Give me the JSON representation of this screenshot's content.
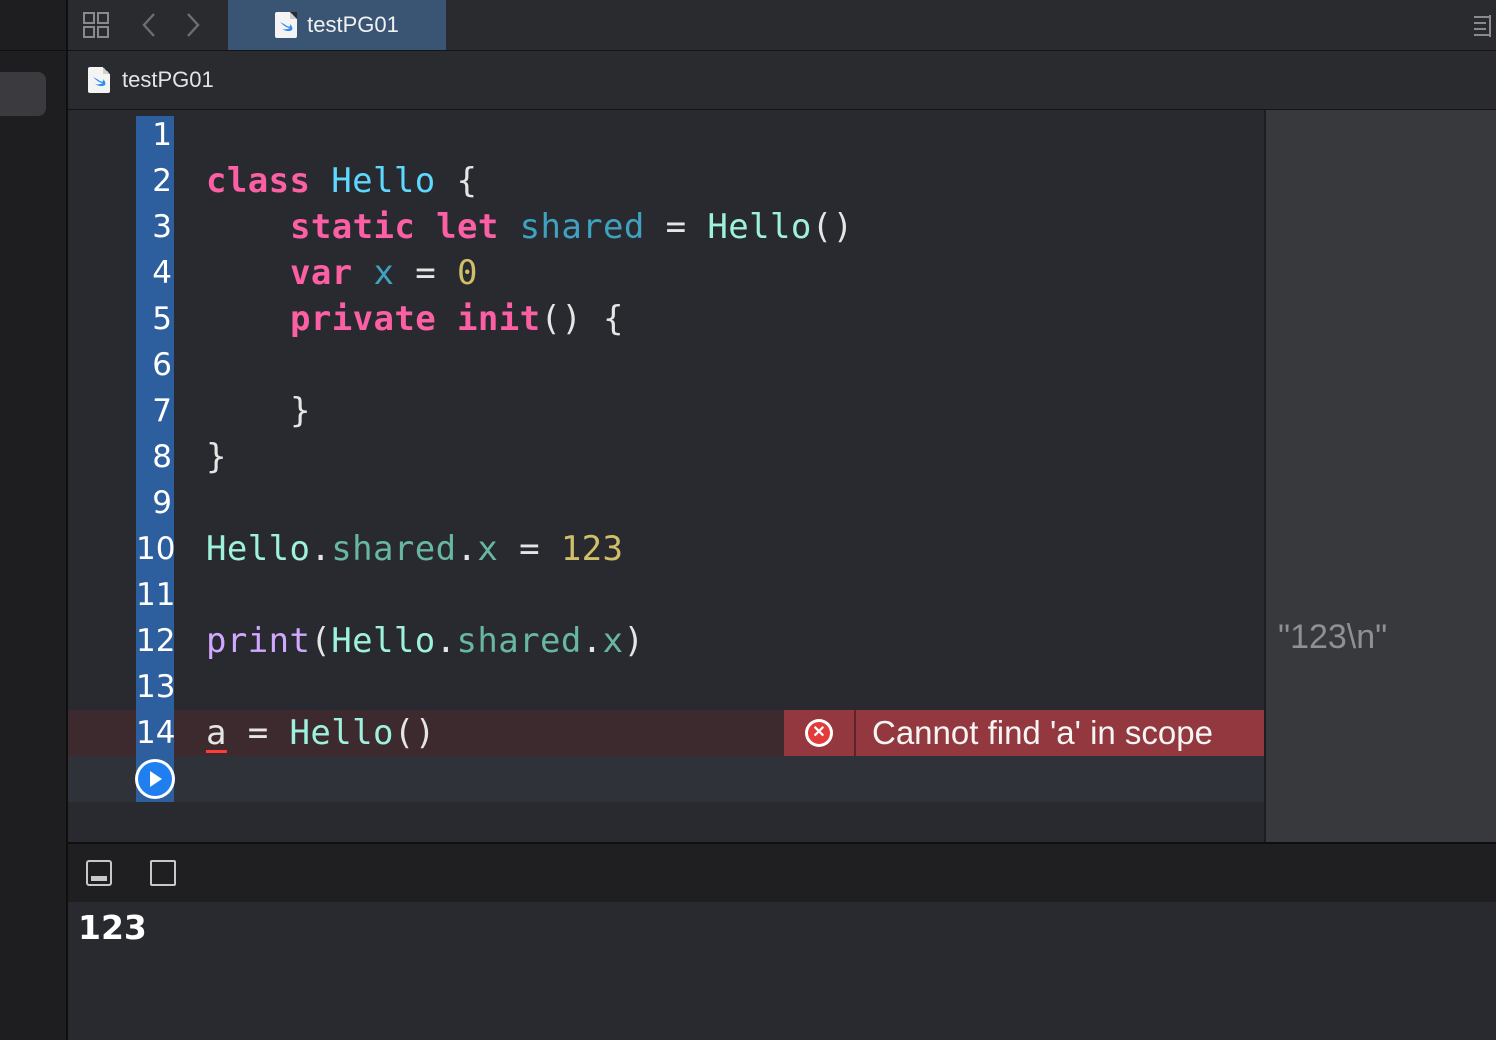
{
  "tab": {
    "label": "testPG01"
  },
  "jumpbar": {
    "label": "testPG01"
  },
  "gutter": {
    "lines": [
      "1",
      "2",
      "3",
      "4",
      "5",
      "6",
      "7",
      "8",
      "9",
      "10",
      "11",
      "12",
      "13",
      "14"
    ]
  },
  "code": {
    "l2": [
      "class",
      " ",
      "Hello",
      " {"
    ],
    "l3": [
      "static",
      " ",
      "let",
      " ",
      "shared",
      " = ",
      "Hello",
      "()"
    ],
    "l4": [
      "var",
      " ",
      "x",
      " = ",
      "0"
    ],
    "l5": [
      "private",
      " ",
      "init",
      "() {"
    ],
    "l7": [
      "}"
    ],
    "l8": [
      "}"
    ],
    "l10": [
      "Hello",
      ".",
      "shared",
      ".",
      "x",
      " = ",
      "123"
    ],
    "l12": [
      "print",
      "(",
      "Hello",
      ".",
      "shared",
      ".",
      "x",
      ")"
    ],
    "l14": [
      "a",
      " = ",
      "Hello",
      "()"
    ]
  },
  "error": {
    "message": "Cannot find 'a' in scope",
    "icon": "error-x-icon",
    "color": "#93383f"
  },
  "results": {
    "line12": "\"123\\n\""
  },
  "console": {
    "output": "123"
  },
  "colors": {
    "keyword": "#fc5fa3",
    "type": "#9ef1dd",
    "number": "#d0bf69",
    "gutter": "#2d5f9e",
    "tab_active": "#3a5574"
  }
}
